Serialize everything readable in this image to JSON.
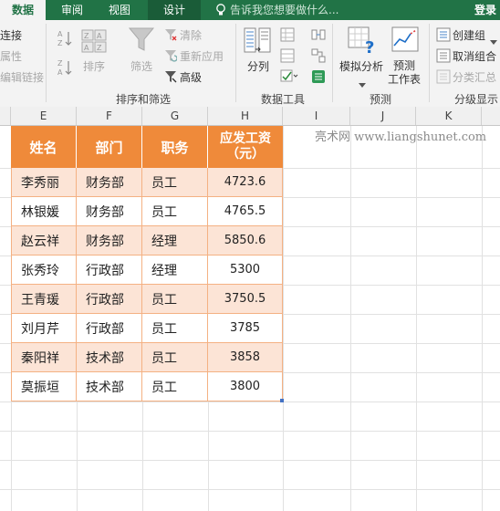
{
  "tabs": [
    {
      "label": "数据",
      "active": true
    },
    {
      "label": "审阅",
      "active": false
    },
    {
      "label": "视图",
      "active": false
    },
    {
      "label": "设计",
      "active": false
    }
  ],
  "tell_me": "告诉我您想要做什么...",
  "login": "登录",
  "ribbon": {
    "connections": {
      "connect": "连接",
      "properties": "属性",
      "edit_links": "编辑链接"
    },
    "sort_filter": {
      "sort": "排序",
      "filter": "筛选",
      "clear": "清除",
      "reapply": "重新应用",
      "advanced": "高级",
      "group_label": "排序和筛选"
    },
    "data_tools": {
      "text_to_columns": "分列",
      "group_label": "数据工具"
    },
    "forecast": {
      "what_if": "模拟分析",
      "forecast_sheet_line1": "预测",
      "forecast_sheet_line2": "工作表",
      "group_label": "预测"
    },
    "outline": {
      "group": "创建组",
      "ungroup": "取消组合",
      "subtotal": "分类汇总",
      "group_label": "分级显示"
    }
  },
  "columns": [
    "E",
    "F",
    "G",
    "H",
    "I",
    "J",
    "K"
  ],
  "table": {
    "headers": [
      "姓名",
      "部门",
      "职务",
      "应发工资（元）"
    ],
    "rows": [
      [
        "李秀丽",
        "财务部",
        "员工",
        "4723.6"
      ],
      [
        "林银媛",
        "财务部",
        "员工",
        "4765.5"
      ],
      [
        "赵云祥",
        "财务部",
        "经理",
        "5850.6"
      ],
      [
        "张秀玲",
        "行政部",
        "经理",
        "5300"
      ],
      [
        "王青瑗",
        "行政部",
        "员工",
        "3750.5"
      ],
      [
        "刘月芹",
        "行政部",
        "员工",
        "3785"
      ],
      [
        "秦阳祥",
        "技术部",
        "员工",
        "3858"
      ],
      [
        "莫振垣",
        "技术部",
        "员工",
        "3800"
      ]
    ]
  },
  "watermark": "亮术网 www.liangshunet.com",
  "colors": {
    "excel_green": "#217346",
    "header_orange": "#ef8a3a",
    "band_light": "#fce4d6",
    "border_orange": "#f4b183"
  }
}
